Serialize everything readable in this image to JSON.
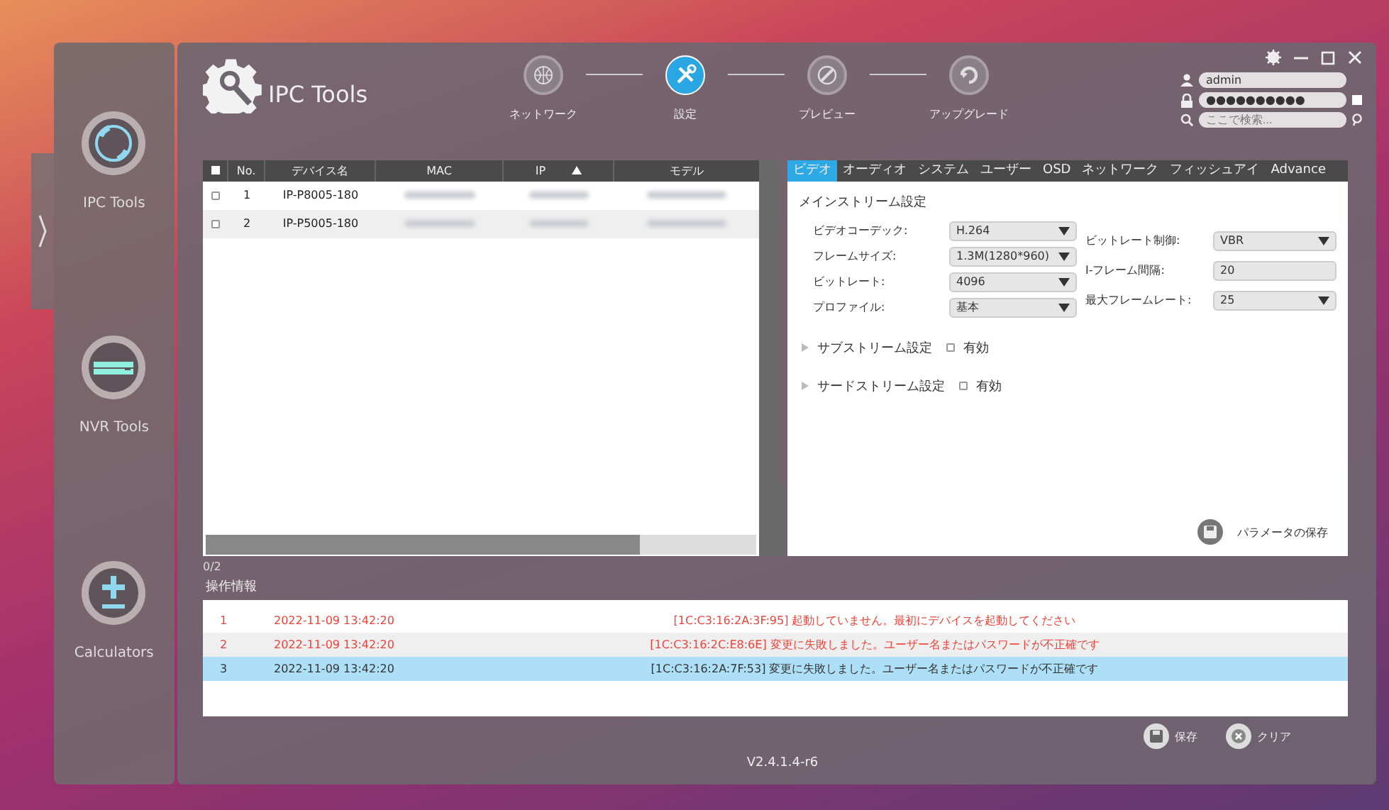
{
  "sidebar": {
    "items": [
      {
        "label": "IPC Tools",
        "kind": "ring"
      },
      {
        "label": "NVR Tools",
        "kind": "nvr"
      },
      {
        "label": "Calculators",
        "kind": "plusminus"
      }
    ]
  },
  "header": {
    "app_name": "IPC Tools",
    "steps": [
      {
        "label": "ネットワーク",
        "kind": "globe",
        "selected": false
      },
      {
        "label": "設定",
        "kind": "tools",
        "selected": true
      },
      {
        "label": "プレビュー",
        "kind": "pen",
        "selected": false
      },
      {
        "label": "アップグレード",
        "kind": "refresh",
        "selected": false
      }
    ],
    "login": {
      "user": "admin",
      "password": "●●●●●●●●●●",
      "remember_checked": false,
      "search_placeholder": "ここで検索..."
    }
  },
  "device_table": {
    "columns": [
      {
        "label": "No.",
        "sorted": false
      },
      {
        "label": "デバイス名",
        "sorted": false
      },
      {
        "label": "MAC",
        "sorted": false
      },
      {
        "label": "IP",
        "sorted": true
      },
      {
        "label": "モデル",
        "sorted": false
      }
    ],
    "all_checked": false,
    "rows": [
      {
        "no": "1",
        "name": "IP-P8005-180",
        "checked": false
      },
      {
        "no": "2",
        "name": "IP-P5005-180",
        "checked": false
      }
    ],
    "count": "0/2"
  },
  "settings": {
    "tabs": [
      {
        "label": "ビデオ",
        "selected": true
      },
      {
        "label": "オーディオ",
        "selected": false
      },
      {
        "label": "システム",
        "selected": false
      },
      {
        "label": "ユーザー",
        "selected": false
      },
      {
        "label": "OSD",
        "selected": false
      },
      {
        "label": "ネットワーク",
        "selected": false
      },
      {
        "label": "フィッシュアイ",
        "selected": false
      },
      {
        "label": "Advance",
        "selected": false
      }
    ],
    "section_title": "メインストリーム設定",
    "left_fields": [
      {
        "label": "ビデオコーデック:",
        "value": "H.264",
        "kind": "select"
      },
      {
        "label": "フレームサイズ:",
        "value": "1.3M(1280*960)",
        "kind": "select"
      },
      {
        "label": "ビットレート:",
        "value": "4096",
        "kind": "select"
      },
      {
        "label": "プロファイル:",
        "value": "基本",
        "kind": "select"
      }
    ],
    "right_fields": [
      {
        "label": "ビットレート制御:",
        "value": "VBR",
        "kind": "select"
      },
      {
        "label": "I-フレーム間隔:",
        "value": "20",
        "kind": "input"
      },
      {
        "label": "最大フレームレート:",
        "value": "25",
        "kind": "select"
      }
    ],
    "streams": [
      {
        "label": "サブストリーム設定",
        "enable_label": "有効",
        "checked": false
      },
      {
        "label": "サードストリーム設定",
        "enable_label": "有効",
        "checked": false
      }
    ],
    "save_button": "パラメータの保存"
  },
  "log": {
    "title": "操作情報",
    "rows": [
      {
        "no": "1",
        "time": "2022-11-09 13:42:20",
        "message": "[1C:C3:16:2A:3F:95] 起動していません。最初にデバイスを起動してください",
        "color": "#e8453c",
        "selected": false
      },
      {
        "no": "2",
        "time": "2022-11-09 13:42:20",
        "message": "[1C:C3:16:2C:E8:6E] 変更に失敗しました。ユーザー名またはパスワードが不正確です",
        "color": "#e8453c",
        "selected": false
      },
      {
        "no": "3",
        "time": "2022-11-09 13:42:20",
        "message": "[1C:C3:16:2A:7F:53] 変更に失敗しました。ユーザー名またはパスワードが不正確です",
        "color": "#333333",
        "selected": true
      }
    ]
  },
  "footer": {
    "save_button": "保存",
    "clear_button": "クリア",
    "version": "V2.4.1.4-r6"
  }
}
